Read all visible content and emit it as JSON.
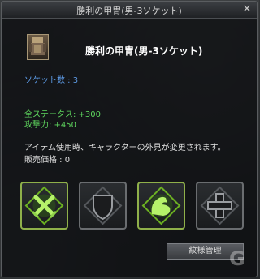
{
  "window": {
    "title": "勝利の甲冑(男-3ソケット)",
    "close_glyph": "✕"
  },
  "item": {
    "icon": "armor-icon",
    "name": "勝利の甲冑(男-3ソケット)",
    "socket_count": "ソケット数 : 3",
    "stats": [
      "全ステータス: +300",
      "攻撃力: +450"
    ],
    "description": "アイテム使用時、キャラクターの外見が変更されます。",
    "price": "販売価格 : 0"
  },
  "slots": [
    {
      "icon": "crossed-swords-icon",
      "active": true
    },
    {
      "icon": "shield-icon",
      "active": false
    },
    {
      "icon": "strength-arm-icon",
      "active": true
    },
    {
      "icon": "cross-icon",
      "active": false
    }
  ],
  "buttons": {
    "engrave": "紋様管理"
  },
  "colors": {
    "socket_text": "#5e9ce8",
    "stat_text": "#5fd85f",
    "active_glow": "#7ed321"
  }
}
